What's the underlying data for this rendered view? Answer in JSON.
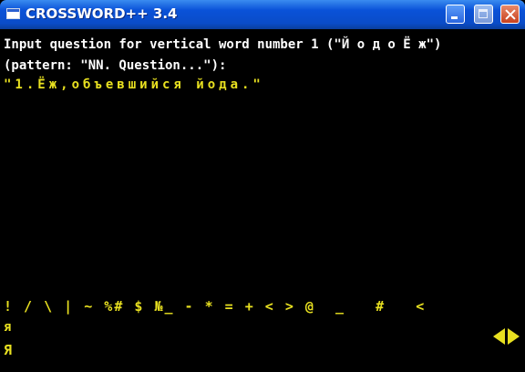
{
  "window": {
    "title": "CROSSWORD++ 3.4"
  },
  "console": {
    "prompt_line1": "Input question for vertical word number 1 (\"Й о д о Ё ж\")",
    "prompt_line2": "(pattern: \"NN. Question...\"):",
    "input_line": "\"1.Ёж,объевшийся йода.\"",
    "charset_line": "! / \\ | ~ %# $ №_ - * = + < > @  _   #   <",
    "char_lower": "я",
    "char_upper": "Я"
  },
  "colors": {
    "background": "#000000",
    "prompt_text": "#ffffff",
    "input_text": "#e8e020",
    "titlebar": "#0a4cc8"
  },
  "icons": [
    "app-icon",
    "minimize-icon",
    "maximize-icon",
    "close-icon",
    "arrow-left-icon",
    "arrow-right-icon"
  ]
}
